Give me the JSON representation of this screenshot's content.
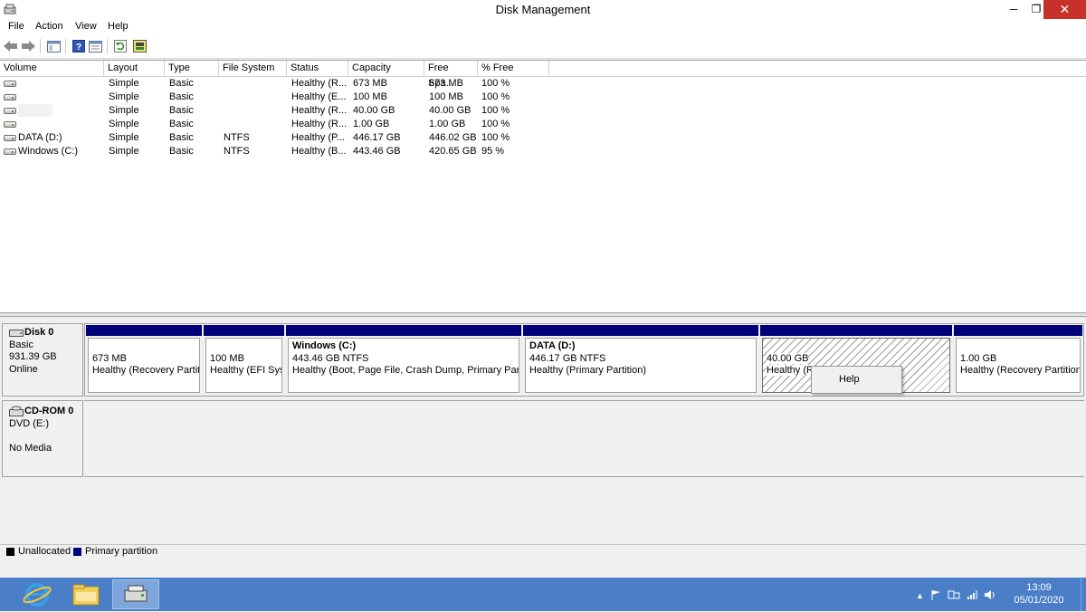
{
  "window": {
    "title": "Disk Management"
  },
  "window_buttons": {
    "minimize": "─",
    "restore": "❐",
    "close": "✕"
  },
  "menu": [
    "File",
    "Action",
    "View",
    "Help"
  ],
  "toolbar_icons": [
    "back-arrow-icon",
    "forward-arrow-icon",
    "console-tree-icon",
    "help-icon",
    "properties-icon",
    "refresh-icon",
    "rescan-disks-icon"
  ],
  "volumes": {
    "columns": [
      "Volume",
      "Layout",
      "Type",
      "File System",
      "Status",
      "Capacity",
      "Free Spa...",
      "% Free"
    ],
    "rows": [
      {
        "volume": "",
        "layout": "Simple",
        "type": "Basic",
        "fs": "",
        "status": "Healthy (R...",
        "capacity": "673 MB",
        "free": "673 MB",
        "pct": "100 %"
      },
      {
        "volume": "",
        "layout": "Simple",
        "type": "Basic",
        "fs": "",
        "status": "Healthy (E...",
        "capacity": "100 MB",
        "free": "100 MB",
        "pct": "100 %"
      },
      {
        "volume": "",
        "layout": "Simple",
        "type": "Basic",
        "fs": "",
        "status": "Healthy (R...",
        "capacity": "40.00 GB",
        "free": "40.00 GB",
        "pct": "100 %"
      },
      {
        "volume": "",
        "layout": "Simple",
        "type": "Basic",
        "fs": "",
        "status": "Healthy (R...",
        "capacity": "1.00 GB",
        "free": "1.00 GB",
        "pct": "100 %"
      },
      {
        "volume": "DATA (D:)",
        "layout": "Simple",
        "type": "Basic",
        "fs": "NTFS",
        "status": "Healthy (P...",
        "capacity": "446.17 GB",
        "free": "446.02 GB",
        "pct": "100 %"
      },
      {
        "volume": "Windows (C:)",
        "layout": "Simple",
        "type": "Basic",
        "fs": "NTFS",
        "status": "Healthy (B...",
        "capacity": "443.46 GB",
        "free": "420.65 GB",
        "pct": "95 %"
      }
    ]
  },
  "disk0": {
    "name": "Disk 0",
    "type": "Basic",
    "size": "931.39 GB",
    "state": "Online",
    "partitions": [
      {
        "title": "",
        "size": "673 MB",
        "status": "Healthy (Recovery Partition)"
      },
      {
        "title": "",
        "size": "100 MB",
        "status": "Healthy (EFI System Partition)"
      },
      {
        "title": "Windows  (C:)",
        "size": "443.46 GB NTFS",
        "status": "Healthy (Boot, Page File, Crash Dump, Primary Partition)"
      },
      {
        "title": "DATA  (D:)",
        "size": "446.17 GB NTFS",
        "status": "Healthy (Primary Partition)"
      },
      {
        "title": "",
        "size": "40.00 GB",
        "status": "Healthy (R"
      },
      {
        "title": "",
        "size": "1.00 GB",
        "status": "Healthy (Recovery Partition)"
      }
    ]
  },
  "cdrom0": {
    "name": "CD-ROM 0",
    "drive": "DVD (E:)",
    "media": "No Media"
  },
  "context_menu": {
    "items": [
      "Help"
    ]
  },
  "legend": [
    {
      "label": "Unallocated",
      "color": "#000000"
    },
    {
      "label": "Primary partition",
      "color": "#00007b"
    }
  ],
  "taskbar": {
    "apps": [
      "internet-explorer-icon",
      "file-explorer-icon",
      "disk-management-icon"
    ],
    "time": "13:09",
    "date": "05/01/2020"
  },
  "colors": {
    "primary_partition": "#00007b",
    "taskbar": "#4a7fc7",
    "close_button": "#c7312a"
  }
}
